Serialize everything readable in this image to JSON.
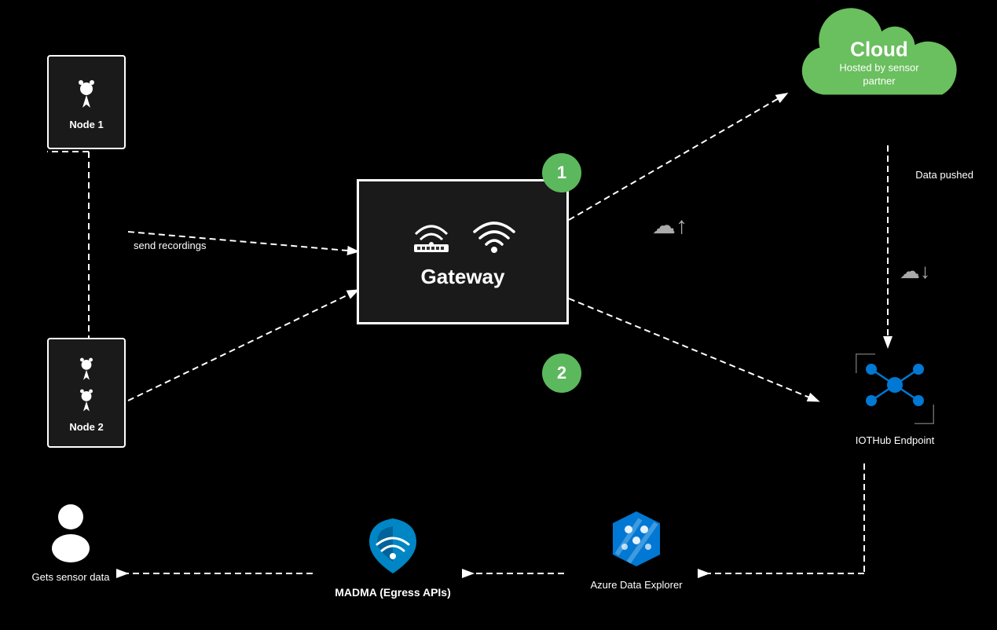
{
  "diagram": {
    "background": "#000000",
    "cloud": {
      "title": "Cloud",
      "subtitle": "Hosted by sensor partner",
      "color": "#6abf5e"
    },
    "gateway": {
      "label": "Gateway"
    },
    "node1": {
      "label": "Node 1"
    },
    "node2": {
      "label": "Node 2"
    },
    "circle1": "1",
    "circle2": "2",
    "iothub": {
      "label": "IOTHub Endpoint"
    },
    "user": {
      "label": "Gets sensor data"
    },
    "madma": {
      "label": "MADMA  (Egress APIs)"
    },
    "azure": {
      "label": "Azure Data Explorer"
    },
    "send_recordings": "send recordings",
    "data_pushed": "Data pushed"
  }
}
